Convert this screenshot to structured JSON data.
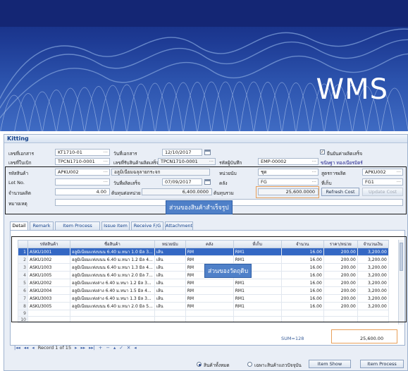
{
  "slide": {
    "title": "WMS"
  },
  "window": {
    "title": "Kitting"
  },
  "form": {
    "doc_no": {
      "label": "เลขที่เอกสาร",
      "value": "KT1710-01"
    },
    "doc_date": {
      "label": "วันที่เอกสาร",
      "value": "12/10/2017"
    },
    "approved": {
      "label": "ยืนยันค่าผลิตเสร็จ",
      "checked": true
    },
    "withdraw_no": {
      "label": "เลขที่ใบเบิก",
      "value": "TPCN1710-0001"
    },
    "receive_no": {
      "label": "เลขที่รับสินค้าผลิตเสร็จ",
      "value": "TPCN1710-0001"
    },
    "approver": {
      "label": "รหัสผู้บันทึก",
      "value": "EMP-00002",
      "name": "ขนิษฐา ทองเนียรมิตร์"
    },
    "product_code": {
      "label": "รหัสสินค้า",
      "value": "APKU002",
      "desc": "อลูมิเนียมฉลุลายกระจก"
    },
    "unit": {
      "label": "หน่วยนับ",
      "value": "ชุด"
    },
    "formula": {
      "label": "สูตรการผลิต",
      "value": "APKU002"
    },
    "lot_no": {
      "label": "Lot No.",
      "value": ""
    },
    "finish_date": {
      "label": "วันที่ผลิตเสร็จ",
      "value": "07/09/2017"
    },
    "warehouse": {
      "label": "คลัง",
      "value": "FG"
    },
    "location": {
      "label": "ที่เก็บ",
      "value": "FG1"
    },
    "qty": {
      "label": "จำนวนผลิต",
      "value": "4.00"
    },
    "cost_per_unit": {
      "label": "ต้นทุนต่อหน่วย",
      "value": "6,400.0000"
    },
    "total_cost": {
      "label": "ต้นทุนรวม",
      "value": "25,600.0000"
    },
    "remark": {
      "label": "หมายเหตุ",
      "value": ""
    },
    "refresh_cost": "Refresh Cost",
    "update_cost": "Update Cost"
  },
  "callouts": {
    "header": "ส่วนของสินค้าสำเร็จรูป",
    "grid": "ส่วนของวัตถุดิบ"
  },
  "tabs": [
    "Detail",
    "Remark",
    "Item Process Detail",
    "Issue Item",
    "Receive F/G",
    "Attachment"
  ],
  "grid": {
    "columns": [
      "",
      "รหัสสินค้า",
      "ชื่อสินค้า",
      "หน่วยนับ",
      "คลัง",
      "ที่เก็บ",
      "จำนวน",
      "ราคา/หน่วย",
      "จำนวนเงิน"
    ],
    "rows": [
      [
        "1",
        "ASKU1001",
        "อลูมิเนียมเเท่งบนน 6.40 ม.หนา 1.0 มิล 3...",
        "เส้น",
        "RM",
        "RM1",
        "16.00",
        "200.00",
        "3,200.00"
      ],
      [
        "2",
        "ASKU1002",
        "อลูมิเนียมเเท่งบนน 6.40 ม.หนา 1.2 มิล 4...",
        "เส้น",
        "RM",
        "RM1",
        "16.00",
        "200.00",
        "3,200.00"
      ],
      [
        "3",
        "ASKU1003",
        "อลูมิเนียมเเท่งบนน 6.40 ม.หนา 1.3 มิล 4...",
        "เส้น",
        "RM",
        "RM1",
        "16.00",
        "200.00",
        "3,200.00"
      ],
      [
        "4",
        "ASKU1005",
        "อลูมิเนียมเเท่งบนน 6.40 ม.หนา 2.0 มิล 7...",
        "เส้น",
        "RM",
        "RM1",
        "16.00",
        "200.00",
        "3,200.00"
      ],
      [
        "5",
        "ASKU2002",
        "อลูมิเนียมเเท่งล่าง 6.40 ม.หนา 1.2 มิล 3...",
        "เส้น",
        "RM",
        "RM1",
        "16.00",
        "200.00",
        "3,200.00"
      ],
      [
        "6",
        "ASKU2004",
        "อลูมิเนียมเเท่งล่าง 6.40 ม.หนา 1.5 มิล 4...",
        "เส้น",
        "RM",
        "RM1",
        "16.00",
        "200.00",
        "3,200.00"
      ],
      [
        "7",
        "ASKU3003",
        "อลูมิเนียมเเท่งล่าง 6.40 ม.หนา 1.3 มิล 3...",
        "เส้น",
        "RM",
        "RM1",
        "16.00",
        "200.00",
        "3,200.00"
      ],
      [
        "8",
        "ASKU3005",
        "อลูมิเนียมเเท่งบนน 6.40 ม.หนา 2.0 มิล 5...",
        "เส้น",
        "RM",
        "RM1",
        "16.00",
        "200.00",
        "3,200.00"
      ],
      [
        "9",
        "",
        "",
        "",
        "",
        "",
        "",
        "",
        ""
      ],
      [
        "10",
        "",
        "",
        "",
        "",
        "",
        "",
        "",
        ""
      ]
    ],
    "sum_qty": "SUM=128",
    "sum_amount": "25,600.00"
  },
  "navigator": {
    "record": "Record 1 of 15"
  },
  "bottom": {
    "radio_all": "สินค้าทั้งหมด",
    "radio_current": "เฉพาะสินค้าเเถวปัจจุบัน",
    "item_show": "Item Show",
    "item_process": "Item Process"
  }
}
